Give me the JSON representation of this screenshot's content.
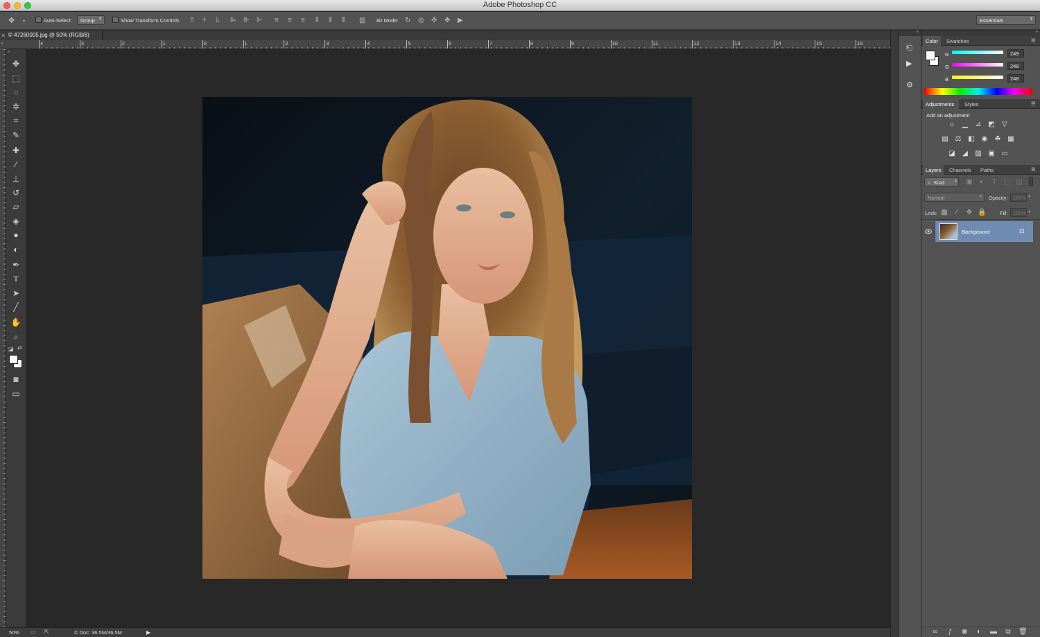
{
  "app": {
    "title": "Adobe Photoshop CC"
  },
  "options_bar": {
    "auto_select_label": "Auto-Select:",
    "auto_select_value": "Group",
    "show_transform_label": "Show Transform Controls",
    "mode_3d_label": "3D Mode:",
    "workspace": "Essentials"
  },
  "document": {
    "tab_title": "© 47260005.jpg @ 50% (RGB/8)",
    "zoom": "50%",
    "doc_size": "© Doc: 36.5M/36.5M"
  },
  "ruler": {
    "marks": [
      "4",
      "3",
      "2",
      "1",
      "0",
      "1",
      "2",
      "3",
      "4",
      "5",
      "6",
      "7",
      "8",
      "9",
      "10",
      "11",
      "12",
      "13",
      "14",
      "15",
      "16"
    ]
  },
  "color_panel": {
    "tabs": [
      "Color",
      "Swatches"
    ],
    "r_label": "R",
    "g_label": "G",
    "b_label": "B",
    "r": "249",
    "g": "248",
    "b": "248"
  },
  "adjustments_panel": {
    "tabs": [
      "Adjustments",
      "Styles"
    ],
    "heading": "Add an adjustment"
  },
  "layers_panel": {
    "tabs": [
      "Layers",
      "Channels",
      "Paths"
    ],
    "filter_kind": "Kind",
    "blend_mode": "Normal",
    "opacity_label": "Opacity:",
    "opacity_value": "100%",
    "lock_label": "Lock:",
    "fill_label": "Fill:",
    "fill_value": "100%",
    "layers": [
      {
        "name": "Background"
      }
    ]
  },
  "colors": {
    "accent_layer": "#6f8bb1",
    "panel": "#535353",
    "canvas": "#282828"
  }
}
